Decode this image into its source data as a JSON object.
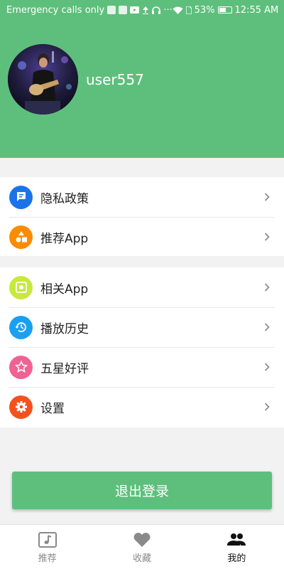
{
  "status_bar": {
    "carrier": "Emergency calls only",
    "battery": "53%",
    "time": "12:55 AM"
  },
  "profile": {
    "username": "user557"
  },
  "menu_group_1": [
    {
      "label": "隐私政策",
      "icon": "chat-icon",
      "color": "#1a73e8"
    },
    {
      "label": "推荐App",
      "icon": "shapes-icon",
      "color": "#fb8c00"
    }
  ],
  "menu_group_2": [
    {
      "label": "相关App",
      "icon": "app-icon",
      "color": "#c6e93a"
    },
    {
      "label": "播放历史",
      "icon": "history-icon",
      "color": "#1aa0f0"
    },
    {
      "label": "五星好评",
      "icon": "star-icon",
      "color": "#f06292"
    },
    {
      "label": "设置",
      "icon": "gear-icon",
      "color": "#f4511e"
    }
  ],
  "logout_label": "退出登录",
  "tabs": [
    {
      "label": "推荐",
      "icon": "music-note-icon"
    },
    {
      "label": "收藏",
      "icon": "heart-icon"
    },
    {
      "label": "我的",
      "icon": "people-icon",
      "active": true
    }
  ],
  "colors": {
    "brand_green": "#5ebf7c"
  }
}
